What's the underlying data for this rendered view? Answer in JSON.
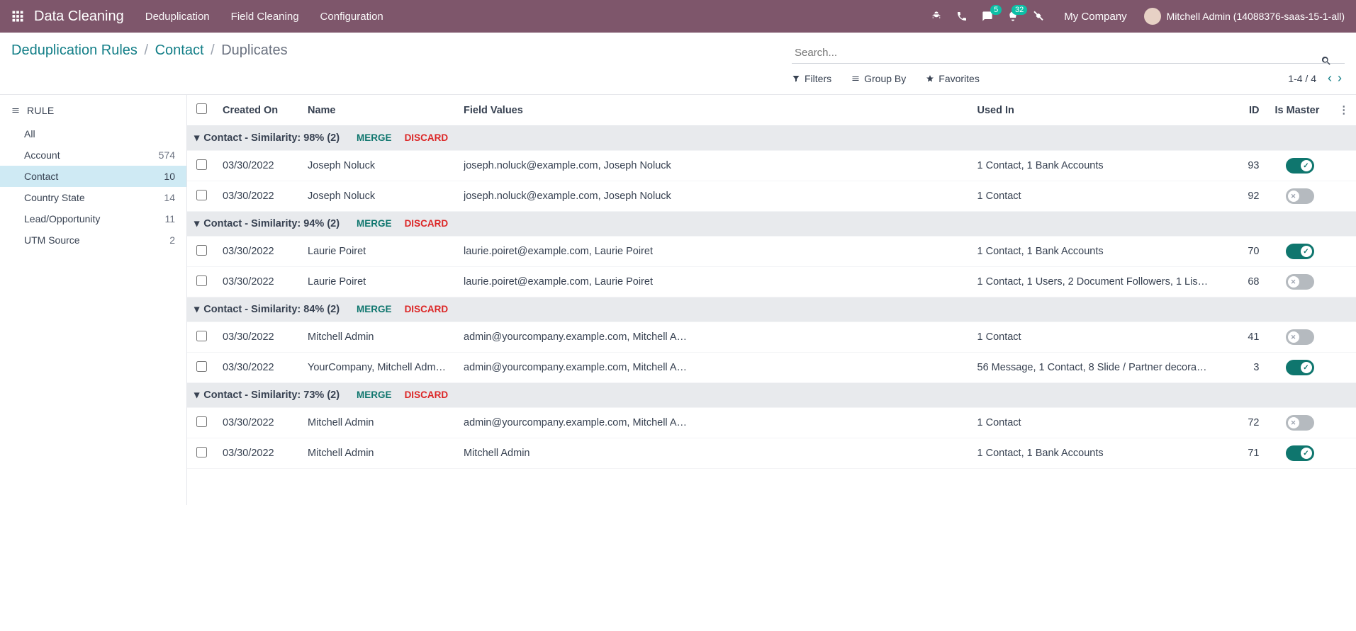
{
  "navbar": {
    "brand": "Data Cleaning",
    "menu": [
      "Deduplication",
      "Field Cleaning",
      "Configuration"
    ],
    "messages_badge": "5",
    "activities_badge": "32",
    "company": "My Company",
    "user": "Mitchell Admin (14088376-saas-15-1-all)"
  },
  "breadcrumb": {
    "root": "Deduplication Rules",
    "mid": "Contact",
    "current": "Duplicates"
  },
  "search": {
    "placeholder": "Search...",
    "filters": "Filters",
    "group_by": "Group By",
    "favorites": "Favorites",
    "pager": "1-4 / 4"
  },
  "sidebar": {
    "header": "RULE",
    "items": [
      {
        "label": "All",
        "count": ""
      },
      {
        "label": "Account",
        "count": "574"
      },
      {
        "label": "Contact",
        "count": "10",
        "active": true
      },
      {
        "label": "Country State",
        "count": "14"
      },
      {
        "label": "Lead/Opportunity",
        "count": "11"
      },
      {
        "label": "UTM Source",
        "count": "2"
      }
    ]
  },
  "columns": {
    "created_on": "Created On",
    "name": "Name",
    "field_values": "Field Values",
    "used_in": "Used In",
    "id": "ID",
    "is_master": "Is Master"
  },
  "actions": {
    "merge": "MERGE",
    "discard": "DISCARD"
  },
  "groups": [
    {
      "title": "Contact - Similarity: 98% (2)",
      "rows": [
        {
          "created": "03/30/2022",
          "name": "Joseph Noluck",
          "field_values": "joseph.noluck@example.com, Joseph Noluck",
          "used_in": "1 Contact, 1 Bank Accounts",
          "id": "93",
          "master": true
        },
        {
          "created": "03/30/2022",
          "name": "Joseph Noluck",
          "field_values": "joseph.noluck@example.com, Joseph Noluck",
          "used_in": "1 Contact",
          "id": "92",
          "master": false
        }
      ]
    },
    {
      "title": "Contact - Similarity: 94% (2)",
      "rows": [
        {
          "created": "03/30/2022",
          "name": "Laurie Poiret",
          "field_values": "laurie.poiret@example.com, Laurie Poiret",
          "used_in": "1 Contact, 1 Bank Accounts",
          "id": "70",
          "master": true
        },
        {
          "created": "03/30/2022",
          "name": "Laurie Poiret",
          "field_values": "laurie.poiret@example.com, Laurie Poiret",
          "used_in": "1 Contact, 1 Users, 2 Document Followers, 1 Lis…",
          "id": "68",
          "master": false
        }
      ]
    },
    {
      "title": "Contact - Similarity: 84% (2)",
      "rows": [
        {
          "created": "03/30/2022",
          "name": "Mitchell Admin",
          "field_values": "admin@yourcompany.example.com, Mitchell A…",
          "used_in": "1 Contact",
          "id": "41",
          "master": false
        },
        {
          "created": "03/30/2022",
          "name": "YourCompany, Mitchell Adm…",
          "field_values": "admin@yourcompany.example.com, Mitchell A…",
          "used_in": "56 Message, 1 Contact, 8 Slide / Partner decora…",
          "id": "3",
          "master": true
        }
      ]
    },
    {
      "title": "Contact - Similarity: 73% (2)",
      "rows": [
        {
          "created": "03/30/2022",
          "name": "Mitchell Admin",
          "field_values": "admin@yourcompany.example.com, Mitchell A…",
          "used_in": "1 Contact",
          "id": "72",
          "master": false
        },
        {
          "created": "03/30/2022",
          "name": "Mitchell Admin",
          "field_values": "Mitchell Admin",
          "used_in": "1 Contact, 1 Bank Accounts",
          "id": "71",
          "master": true
        }
      ]
    }
  ]
}
